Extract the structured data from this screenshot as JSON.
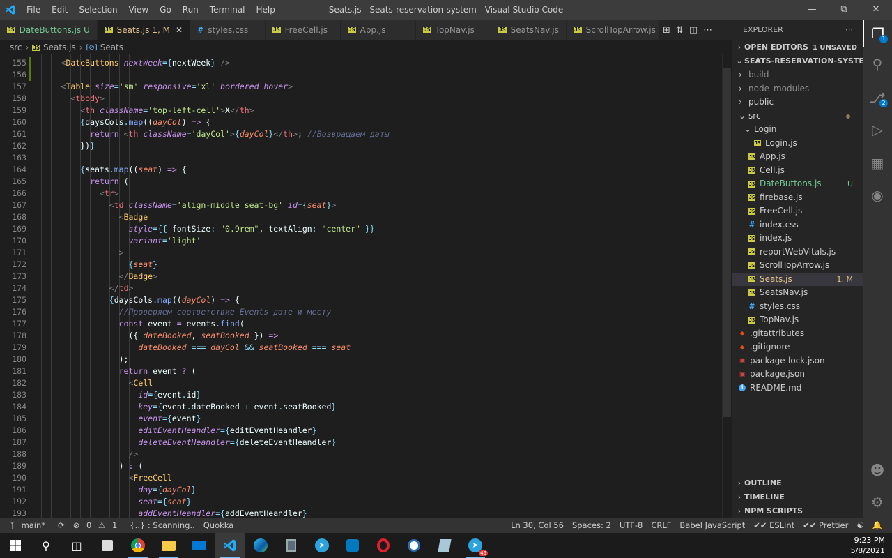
{
  "window": {
    "title": "Seats.js - Seats-reservation-system - Visual Studio Code",
    "menu": [
      "File",
      "Edit",
      "Selection",
      "View",
      "Go",
      "Run",
      "Terminal",
      "Help"
    ]
  },
  "tabs": [
    {
      "name": "DateButtons.js",
      "badge": "U"
    },
    {
      "name": "Seats.js",
      "badge": "1, M",
      "active": true
    },
    {
      "name": "styles.css",
      "type": "css"
    },
    {
      "name": "FreeCell.js"
    },
    {
      "name": "App.js"
    },
    {
      "name": "TopNav.js"
    },
    {
      "name": "SeatsNav.js"
    },
    {
      "name": "ScrollTopArrow.js"
    }
  ],
  "breadcrumb": {
    "folder": "src",
    "file": "Seats.js",
    "symbol": "Seats"
  },
  "code_lines": [
    {
      "n": "155",
      "html": "      <span class='t'>&lt;</span><span class='cp'>DateButtons</span> <span class='at'>nextWeek</span><span class='br'>={</span><span class='vr'>nextWeek</span><span class='br'>}</span> <span class='t'>/&gt;</span>"
    },
    {
      "n": "156",
      "html": ""
    },
    {
      "n": "157",
      "html": "      <span class='t'>&lt;</span><span class='cp'>Table</span> <span class='at'>size</span><span class='br'>=</span><span class='st'>'sm'</span> <span class='at'>responsive</span><span class='br'>=</span><span class='st'>'xl'</span> <span class='at'>bordered</span> <span class='at'>hover</span><span class='t'>&gt;</span>"
    },
    {
      "n": "158",
      "html": "        <span class='t'>&lt;</span><span class='tg'>tbody</span><span class='t'>&gt;</span>"
    },
    {
      "n": "159",
      "html": "          <span class='t'>&lt;</span><span class='tg'>th</span> <span class='at'>className</span><span class='br'>=</span><span class='st'>'top-left-cell'</span><span class='t'>&gt;</span><span class='pl'>X</span><span class='t'>&lt;/</span><span class='tg'>th</span><span class='t'>&gt;</span>"
    },
    {
      "n": "160",
      "html": "          <span class='br'>{</span><span class='vr'>daysCols</span><span class='br'>.</span><span class='fn'>map</span><span class='pl'>((</span><span class='pm'>dayCol</span><span class='pl'>)</span> <span class='kw'>=&gt;</span> <span class='pl'>{</span>"
    },
    {
      "n": "161",
      "html": "            <span class='kw'>return</span> <span class='t'>&lt;</span><span class='tg'>th</span> <span class='at'>className</span><span class='br'>=</span><span class='st'>'dayCol'</span><span class='t'>&gt;</span><span class='br'>{</span><span class='pm'>dayCol</span><span class='br'>}</span><span class='t'>&lt;/</span><span class='tg'>th</span><span class='t'>&gt;</span><span class='pl'>;</span> <span class='cm'>//Возвращаем даты</span>"
    },
    {
      "n": "162",
      "html": "          <span class='pl'>})</span><span class='br'>}</span>"
    },
    {
      "n": "163",
      "html": ""
    },
    {
      "n": "164",
      "html": "          <span class='br'>{</span><span class='vr'>seats</span><span class='br'>.</span><span class='fn'>map</span><span class='pl'>((</span><span class='pm'>seat</span><span class='pl'>)</span> <span class='kw'>=&gt;</span> <span class='pl'>{</span>"
    },
    {
      "n": "165",
      "html": "            <span class='kw'>return</span> <span class='pl'>(</span>"
    },
    {
      "n": "166",
      "html": "              <span class='t'>&lt;</span><span class='tg'>tr</span><span class='t'>&gt;</span>"
    },
    {
      "n": "167",
      "html": "                <span class='t'>&lt;</span><span class='tg'>td</span> <span class='at'>className</span><span class='br'>=</span><span class='st'>'align-middle seat-bg'</span> <span class='at'>id</span><span class='br'>={</span><span class='pm'>seat</span><span class='br'>}</span><span class='t'>&gt;</span>"
    },
    {
      "n": "168",
      "html": "                  <span class='t'>&lt;</span><span class='cp'>Badge</span>"
    },
    {
      "n": "169",
      "html": "                    <span class='at'>style</span><span class='br'>={{</span> <span class='vr'>fontSize</span><span class='br'>:</span> <span class='st'>\"0.9rem\"</span><span class='pl'>,</span> <span class='vr'>textAlign</span><span class='br'>:</span> <span class='st'>\"center\"</span> <span class='br'>}}</span>"
    },
    {
      "n": "170",
      "html": "                    <span class='at'>variant</span><span class='br'>=</span><span class='st'>'light'</span>"
    },
    {
      "n": "171",
      "html": "                  <span class='t'>&gt;</span>"
    },
    {
      "n": "172",
      "html": "                    <span class='br'>{</span><span class='pm'>seat</span><span class='br'>}</span>"
    },
    {
      "n": "173",
      "html": "                  <span class='t'>&lt;/</span><span class='cp'>Badge</span><span class='t'>&gt;</span>"
    },
    {
      "n": "174",
      "html": "                <span class='t'>&lt;/</span><span class='tg'>td</span><span class='t'>&gt;</span>"
    },
    {
      "n": "175",
      "html": "                <span class='br'>{</span><span class='vr'>daysCols</span><span class='br'>.</span><span class='fn'>map</span><span class='pl'>((</span><span class='pm'>dayCol</span><span class='pl'>)</span> <span class='kw'>=&gt;</span> <span class='pl'>{</span>"
    },
    {
      "n": "176",
      "html": "                  <span class='cm'>//Проверяем соответствие Events дате и месту</span>"
    },
    {
      "n": "177",
      "html": "                  <span class='kw'>const</span> <span class='vr'>event</span> <span class='kw'>=</span> <span class='vr'>events</span><span class='br'>.</span><span class='fn'>find</span><span class='pl'>(</span>"
    },
    {
      "n": "178",
      "html": "                    <span class='pl'>({</span> <span class='pm'>dateBooked</span><span class='pl'>,</span> <span class='pm'>seatBooked</span> <span class='pl'>})</span> <span class='kw'>=&gt;</span>"
    },
    {
      "n": "179",
      "html": "                      <span class='pm'>dateBooked</span> <span class='br'>===</span> <span class='pm'>dayCol</span> <span class='br'>&amp;&amp;</span> <span class='pm'>seatBooked</span> <span class='br'>===</span> <span class='pm'>seat</span>"
    },
    {
      "n": "180",
      "html": "                  <span class='pl'>);</span>"
    },
    {
      "n": "181",
      "html": "                  <span class='kw'>return</span> <span class='vr'>event</span> <span class='kw'>?</span> <span class='pl'>(</span>"
    },
    {
      "n": "182",
      "html": "                    <span class='t'>&lt;</span><span class='cp'>Cell</span>"
    },
    {
      "n": "183",
      "html": "                      <span class='at'>id</span><span class='br'>={</span><span class='vr'>event</span><span class='br'>.</span><span class='vr'>id</span><span class='br'>}</span>"
    },
    {
      "n": "184",
      "html": "                      <span class='at'>key</span><span class='br'>={</span><span class='vr'>event</span><span class='br'>.</span><span class='vr'>dateBooked</span> <span class='br'>+</span> <span class='vr'>event</span><span class='br'>.</span><span class='vr'>seatBooked</span><span class='br'>}</span>"
    },
    {
      "n": "185",
      "html": "                      <span class='at'>event</span><span class='br'>={</span><span class='vr'>event</span><span class='br'>}</span>"
    },
    {
      "n": "186",
      "html": "                      <span class='at'>editEventHeandler</span><span class='br'>={</span><span class='vr'>editEventHeandler</span><span class='br'>}</span>"
    },
    {
      "n": "187",
      "html": "                      <span class='at'>deleteEventHeandler</span><span class='br'>={</span><span class='vr'>deleteEventHeandler</span><span class='br'>}</span>"
    },
    {
      "n": "188",
      "html": "                    <span class='t'>/&gt;</span>"
    },
    {
      "n": "189",
      "html": "                  <span class='pl'>)</span> <span class='kw'>:</span> <span class='pl'>(</span>"
    },
    {
      "n": "190",
      "html": "                    <span class='t'>&lt;</span><span class='cp'>FreeCell</span>"
    },
    {
      "n": "191",
      "html": "                      <span class='at'>day</span><span class='br'>={</span><span class='pm'>dayCol</span><span class='br'>}</span>"
    },
    {
      "n": "192",
      "html": "                      <span class='at'>seat</span><span class='br'>={</span><span class='pm'>seat</span><span class='br'>}</span>"
    },
    {
      "n": "193",
      "html": "                      <span class='at'>addEventHeandler</span><span class='br'>={</span><span class='vr'>addEventHeandler</span><span class='br'>}</span>"
    }
  ],
  "explorer": {
    "header": "EXPLORER",
    "open_editors": "OPEN EDITORS",
    "unsaved": "1 UNSAVED",
    "project": "SEATS-RESERVATION-SYSTEM",
    "items": [
      {
        "name": "build",
        "kind": "folder",
        "depth": 0,
        "dim": true,
        "chev": "›"
      },
      {
        "name": "node_modules",
        "kind": "folder",
        "depth": 0,
        "dim": true,
        "chev": "›"
      },
      {
        "name": "public",
        "kind": "folder",
        "depth": 0,
        "chev": "›"
      },
      {
        "name": "src",
        "kind": "folder",
        "depth": 0,
        "chev": "⌄",
        "dot": true
      },
      {
        "name": "Login",
        "kind": "folder",
        "depth": 1,
        "chev": "⌄"
      },
      {
        "name": "Login.js",
        "kind": "js",
        "depth": 2
      },
      {
        "name": "App.js",
        "kind": "js",
        "depth": 1
      },
      {
        "name": "Cell.js",
        "kind": "js",
        "depth": 1
      },
      {
        "name": "DateButtons.js",
        "kind": "js",
        "depth": 1,
        "status": "U",
        "color": "green"
      },
      {
        "name": "firebase.js",
        "kind": "js",
        "depth": 1
      },
      {
        "name": "FreeCell.js",
        "kind": "js",
        "depth": 1
      },
      {
        "name": "index.css",
        "kind": "css",
        "depth": 1
      },
      {
        "name": "index.js",
        "kind": "js",
        "depth": 1
      },
      {
        "name": "reportWebVitals.js",
        "kind": "js",
        "depth": 1
      },
      {
        "name": "ScrollTopArrow.js",
        "kind": "js",
        "depth": 1
      },
      {
        "name": "Seats.js",
        "kind": "js",
        "depth": 1,
        "status": "1, M",
        "color": "yellow",
        "selected": true
      },
      {
        "name": "SeatsNav.js",
        "kind": "js",
        "depth": 1
      },
      {
        "name": "styles.css",
        "kind": "css",
        "depth": 1
      },
      {
        "name": "TopNav.js",
        "kind": "js",
        "depth": 1
      },
      {
        "name": ".gitattributes",
        "kind": "git",
        "depth": 0
      },
      {
        "name": ".gitignore",
        "kind": "git",
        "depth": 0
      },
      {
        "name": "package-lock.json",
        "kind": "json",
        "depth": 0
      },
      {
        "name": "package.json",
        "kind": "json",
        "depth": 0
      },
      {
        "name": "README.md",
        "kind": "info",
        "depth": 0
      }
    ],
    "bottom_sections": [
      "OUTLINE",
      "TIMELINE",
      "NPM SCRIPTS"
    ]
  },
  "activity_badges": {
    "explorer": "1",
    "scm": "2"
  },
  "status": {
    "branch": "main*",
    "problems": "0",
    "warnings": "1",
    "scanning": "{..} : Scanning..",
    "quokka": "Quokka",
    "position": "Ln 30, Col 56",
    "spaces": "Spaces: 2",
    "encoding": "UTF-8",
    "eol": "CRLF",
    "language": "Babel JavaScript",
    "eslint": "✔✔ ESLint",
    "prettier": "✔✔ Prettier"
  },
  "taskbar": {
    "time": "9:23 PM",
    "date": "5/8/2021",
    "telegram_badge": "46"
  },
  "colors": {
    "accent": "#007acc",
    "titlebar": "#3c3c3c",
    "editor": "#1e1e1e",
    "sidebar": "#252526"
  }
}
